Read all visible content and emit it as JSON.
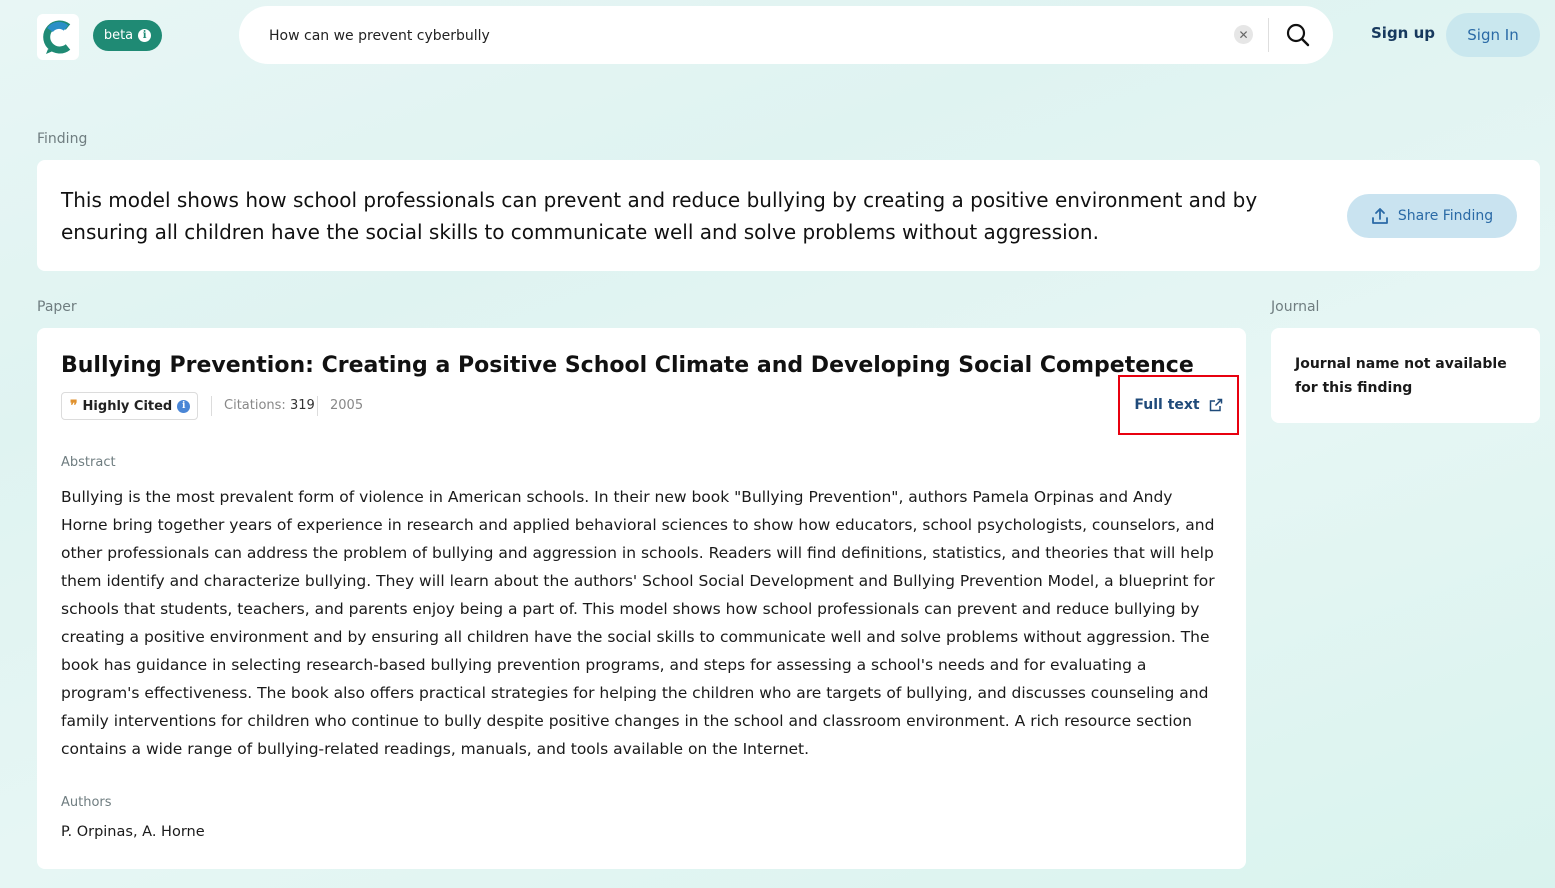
{
  "header": {
    "beta_label": "beta",
    "search_value": "How can we prevent cyberbully",
    "signup_label": "Sign up",
    "signin_label": "Sign In"
  },
  "finding": {
    "section_label": "Finding",
    "text": "This model shows how school professionals can prevent and reduce bullying by creating a positive environment and by ensuring all children have the social skills to communicate well and solve problems without aggression.",
    "share_label": "Share Finding"
  },
  "paper": {
    "section_label": "Paper",
    "title": "Bullying Prevention: Creating a Positive School Climate and Developing Social Competence",
    "badge_label": "Highly Cited",
    "citations_label": "Citations:",
    "citations_value": "319",
    "year": "2005",
    "full_text_label": "Full text",
    "abstract_label": "Abstract",
    "abstract": "Bullying is the most prevalent form of violence in American schools. In their new book \"Bullying Prevention\", authors Pamela Orpinas and Andy Horne bring together years of experience in research and applied behavioral sciences to show how educators, school psychologists, counselors, and other professionals can address the problem of bullying and aggression in schools. Readers will find definitions, statistics, and theories that will help them identify and characterize bullying. They will learn about the authors' School Social Development and Bullying Prevention Model, a blueprint for schools that students, teachers, and parents enjoy being a part of. This model shows how school professionals can prevent and reduce bullying by creating a positive environment and by ensuring all children have the social skills to communicate well and solve problems without aggression. The book has guidance in selecting research-based bullying prevention programs, and steps for assessing a school's needs and for evaluating a program's effectiveness. The book also offers practical strategies for helping the children who are targets of bullying, and discusses counseling and family interventions for children who continue to bully despite positive changes in the school and classroom environment. A rich resource section contains a wide range of bullying-related readings, manuals, and tools available on the Internet.",
    "authors_label": "Authors",
    "authors": "P. Orpinas, A. Horne"
  },
  "journal": {
    "section_label": "Journal",
    "text": "Journal name not available for this finding"
  },
  "colors": {
    "brand": "#1f8a74",
    "accent_blue": "#2a6aa6",
    "highlight_red": "#e8000f"
  }
}
